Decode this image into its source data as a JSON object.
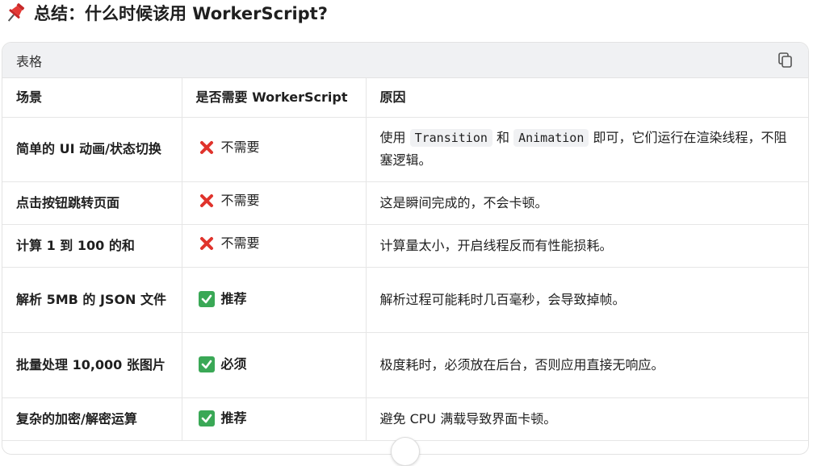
{
  "heading": {
    "title": "总结：什么时候该用 WorkerScript?"
  },
  "table_card": {
    "label": "表格",
    "headers": [
      "场景",
      "是否需要 WorkerScript",
      "原因"
    ],
    "rows": [
      {
        "scene": "简单的 UI 动画/状态切换",
        "need_icon": "cross-mark-icon",
        "need": "不需要",
        "reason_pre": "使用 ",
        "code1": "Transition",
        "reason_mid": " 和 ",
        "code2": "Animation",
        "reason_post": " 即可，它们运行在渲染线程，不阻塞逻辑。"
      },
      {
        "scene": "点击按钮跳转页面",
        "need_icon": "cross-mark-icon",
        "need": "不需要",
        "reason": "这是瞬间完成的，不会卡顿。"
      },
      {
        "scene": "计算 1 到 100 的和",
        "need_icon": "cross-mark-icon",
        "need": "不需要",
        "reason": "计算量太小，开启线程反而有性能损耗。"
      },
      {
        "scene": "解析 5MB 的 JSON 文件",
        "need_icon": "check-mark-icon",
        "need": "推荐",
        "reason": "解析过程可能耗时几百毫秒，会导致掉帧。"
      },
      {
        "scene": "批量处理 10,000 张图片",
        "need_icon": "check-mark-icon",
        "need": "必须",
        "reason": "极度耗时，必须放在后台，否则应用直接无响应。"
      },
      {
        "scene": "复杂的加密/解密运算",
        "need_icon": "check-mark-icon",
        "need": "推荐",
        "reason": "避免 CPU 满载导致界面卡顿。"
      }
    ]
  },
  "colors": {
    "cross": "#e0332c",
    "check": "#3aa856",
    "card_header_bg": "#f0f1f3"
  }
}
